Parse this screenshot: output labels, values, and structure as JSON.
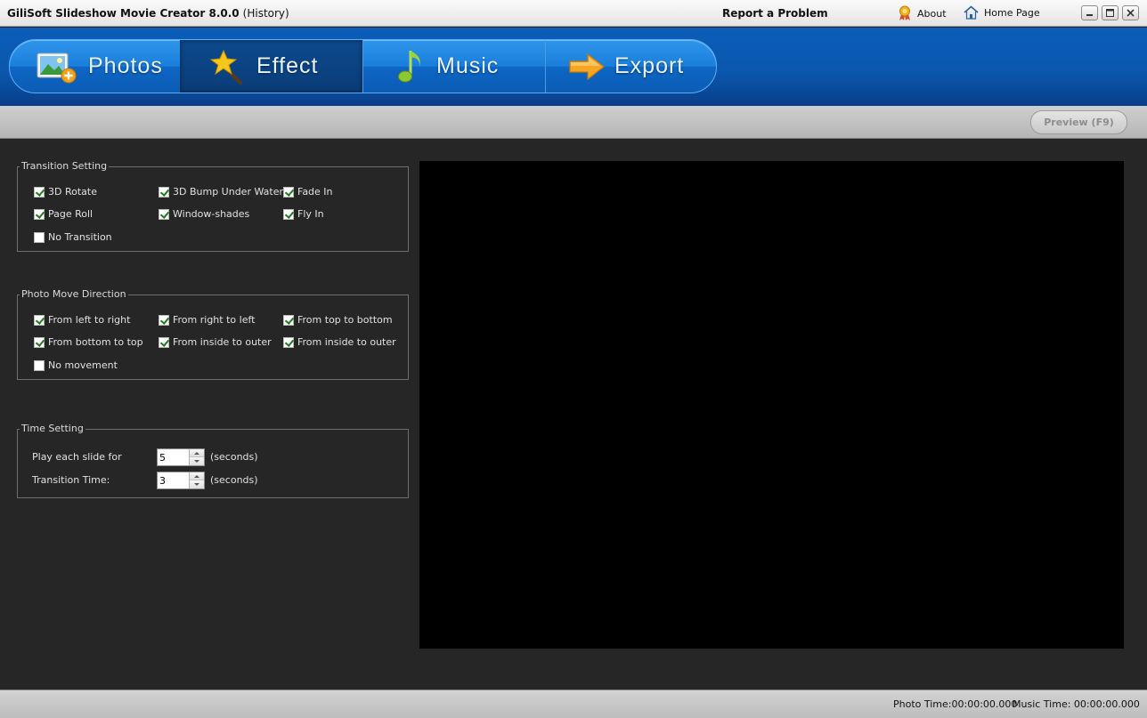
{
  "window": {
    "title": "GiliSoft Slideshow Movie Creator 8.0.0",
    "subtitle": "(History)",
    "report_label": "Report a Problem",
    "about_label": "About",
    "homepage_label": "Home Page"
  },
  "nav": {
    "tabs": [
      {
        "label": "Photos",
        "icon": "photo-add-icon"
      },
      {
        "label": "Effect",
        "icon": "magic-star-icon"
      },
      {
        "label": "Music",
        "icon": "music-note-icon"
      },
      {
        "label": "Export",
        "icon": "arrow-right-icon"
      }
    ],
    "active": "Effect"
  },
  "toolbar": {
    "preview_label": "Preview (F9)"
  },
  "transition": {
    "legend": "Transition Setting",
    "options": [
      {
        "label": "3D Rotate",
        "checked": true
      },
      {
        "label": "3D Bump Under Water",
        "checked": true
      },
      {
        "label": "Fade In",
        "checked": true
      },
      {
        "label": "Page Roll",
        "checked": true
      },
      {
        "label": "Window-shades",
        "checked": true
      },
      {
        "label": "Fly In",
        "checked": true
      },
      {
        "label": "No Transition",
        "checked": false
      }
    ]
  },
  "direction": {
    "legend": "Photo Move Direction",
    "options": [
      {
        "label": "From left to right",
        "checked": true
      },
      {
        "label": "From right to left",
        "checked": true
      },
      {
        "label": "From top to bottom",
        "checked": true
      },
      {
        "label": "From bottom to top",
        "checked": true
      },
      {
        "label": "From inside to outer",
        "checked": true
      },
      {
        "label": "From inside to outer",
        "checked": true
      },
      {
        "label": "No movement",
        "checked": false
      }
    ]
  },
  "time": {
    "legend": "Time Setting",
    "slide_label": "Play each slide for",
    "slide_value": "5",
    "transition_label": "Transition Time:",
    "transition_value": "3",
    "unit": "(seconds)"
  },
  "status": {
    "photo_time": "Photo Time:00:00:00.000",
    "music_time": "Music Time:  00:00:00.000"
  },
  "colors": {
    "nav_blue": "#0b5db8",
    "nav_pill": "#1a7fdc",
    "panel_bg": "#262626",
    "preview_bg": "#000000",
    "check_green": "#1f7a1f"
  }
}
